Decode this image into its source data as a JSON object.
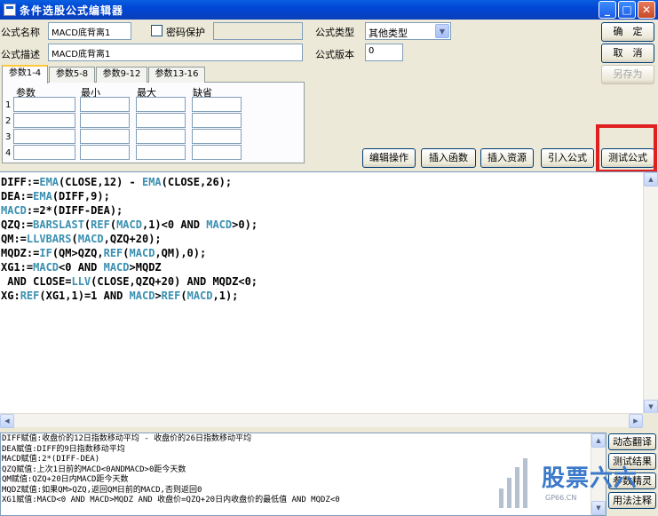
{
  "window": {
    "title": "条件选股公式编辑器",
    "min": "_",
    "max": "□",
    "close": "✕"
  },
  "form": {
    "name_label": "公式名称",
    "name_value": "MACD底背离1",
    "password_label": "密码保护",
    "desc_label": "公式描述",
    "desc_value": "MACD底背离1",
    "type_label": "公式类型",
    "type_value": "其他类型",
    "version_label": "公式版本",
    "version_value": "0"
  },
  "buttons": {
    "ok": "确　定",
    "cancel": "取　消",
    "save_as": "另存为",
    "edit_ops": "编辑操作",
    "insert_func": "插入函数",
    "insert_res": "插入资源",
    "import": "引入公式",
    "test": "测试公式"
  },
  "tabs": [
    "参数1-4",
    "参数5-8",
    "参数9-12",
    "参数13-16"
  ],
  "param_headers": [
    "参数",
    "最小",
    "最大",
    "缺省"
  ],
  "param_rows": [
    "1",
    "2",
    "3",
    "4"
  ],
  "code": {
    "l1": [
      "DIFF:=",
      "EMA",
      "(CLOSE,12) - ",
      "EMA",
      "(CLOSE,26);"
    ],
    "l2": [
      "DEA:=",
      "EMA",
      "(DIFF,9);"
    ],
    "l3": [
      "MACD",
      ":=2*(DIFF-DEA);"
    ],
    "l4": [
      "QZQ:=",
      "BARSLAST",
      "(",
      "REF",
      "(",
      "MACD",
      ",1)<0 AND ",
      "MACD",
      ">0);"
    ],
    "l5": [
      "QM:=",
      "LLVBARS",
      "(",
      "MACD",
      ",QZQ+20);"
    ],
    "l6": [
      "MQDZ:=",
      "IF",
      "(QM>QZQ,",
      "REF",
      "(",
      "MACD",
      ",QM),0);"
    ],
    "l7": [
      "XG1:=",
      "MACD",
      "<0 AND ",
      "MACD",
      ">MQDZ"
    ],
    "l8": [
      " AND CLOSE=",
      "LLV",
      "(CLOSE,QZQ+20) AND MQDZ<0;"
    ],
    "l9": [
      "XG:",
      "REF",
      "(XG1,1)=1 AND ",
      "MACD",
      ">",
      "REF",
      "(",
      "MACD",
      ",1);"
    ]
  },
  "explain": [
    "DIFF赋值:收盘价的12日指数移动平均 - 收盘价的26日指数移动平均",
    "DEA赋值:DIFF的9日指数移动平均",
    "MACD赋值:2*(DIFF-DEA)",
    "QZQ赋值:上次1日前的MACD<0ANDMACD>0距今天数",
    "QM赋值:QZQ+20日内MACD距今天数",
    "MQDZ赋值:如果QM>QZQ,返回QM日前的MACD,否则返回0",
    "XG1赋值:MACD<0 AND MACD>MQDZ AND 收盘价=QZQ+20日内收盘价的最低值 AND MQDZ<0"
  ],
  "side_buttons": [
    "动态翻译",
    "测试结果",
    "参数精灵",
    "用法注释"
  ],
  "watermark": {
    "text": "股票六六",
    "url": "GP66.CN"
  },
  "colors": {
    "function": "#3a8fb0",
    "highlight": "#e02020",
    "titlebar": "#0046d5"
  }
}
